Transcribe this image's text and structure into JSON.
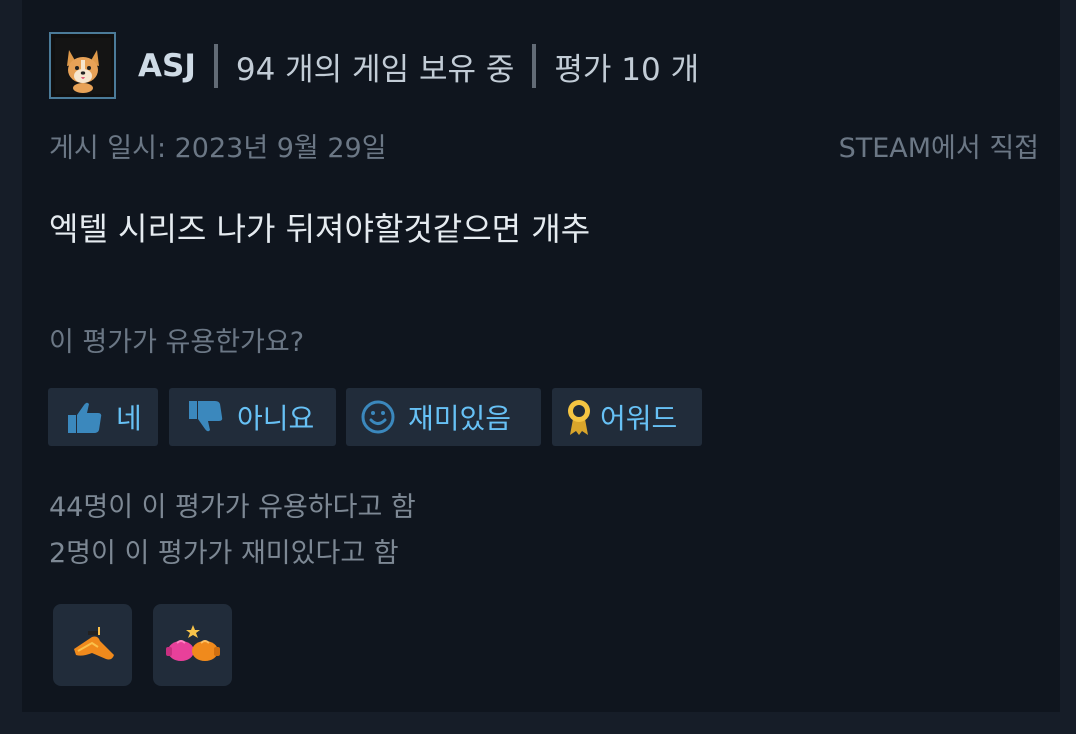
{
  "author": {
    "name": "ASJ",
    "games_owned": "94 개의 게임 보유 중",
    "reviews": "평가 10 개"
  },
  "posted": "게시 일시: 2023년 9월 29일",
  "source": "STEAM에서 직접",
  "review_text": "엑텔 시리즈 나가 뒤져야할것같으면 개추",
  "helpful_question": "이 평가가 유용한가요?",
  "buttons": {
    "yes": "네",
    "no": "아니요",
    "funny": "재미있음",
    "award": "어워드"
  },
  "stats": {
    "helpful": "44명이 이 평가가 유용하다고 함",
    "funny": "2명이 이 평가가 재미있다고 함"
  },
  "awards": [
    "orange-pointer-award-icon",
    "boxing-gloves-award-icon"
  ],
  "colors": {
    "card_bg": "#0f151e",
    "button_bg": "#212c3a",
    "button_text": "#67c1f5",
    "award_gold": "#f5c542"
  }
}
